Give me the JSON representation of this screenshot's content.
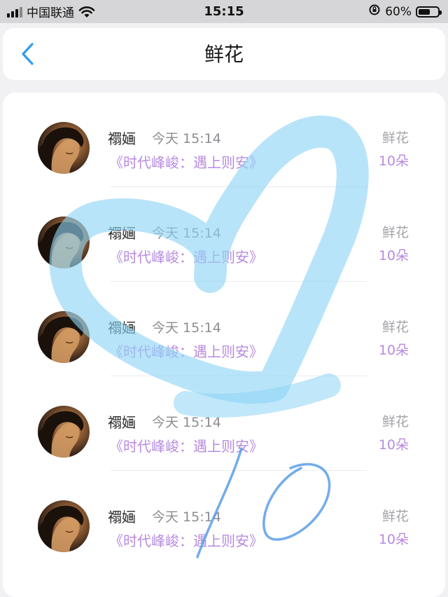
{
  "status_bar": {
    "carrier": "中国联通",
    "time": "15:15",
    "battery_percent": "60%",
    "battery_level": 0.6,
    "icons": [
      "signal-icon",
      "wifi-icon",
      "orientation-lock-icon",
      "battery-icon"
    ]
  },
  "nav": {
    "back_icon": "chevron-left-icon",
    "title": "鲜花"
  },
  "records": [
    {
      "name": "禤婳",
      "time": "今天 15:14",
      "book": "《时代峰峻：遇上则安》",
      "gift": "鲜花",
      "count": "10朵"
    },
    {
      "name": "禤婳",
      "time": "今天 15:14",
      "book": "《时代峰峻：遇上则安》",
      "gift": "鲜花",
      "count": "10朵"
    },
    {
      "name": "禤婳",
      "time": "今天 15:14",
      "book": "《时代峰峻：遇上则安》",
      "gift": "鲜花",
      "count": "10朵"
    },
    {
      "name": "禤婳",
      "time": "今天 15:14",
      "book": "《时代峰峻：遇上则安》",
      "gift": "鲜花",
      "count": "10朵"
    },
    {
      "name": "禤婳",
      "time": "今天 15:14",
      "book": "《时代峰峻：遇上则安》",
      "gift": "鲜花",
      "count": "10朵"
    }
  ],
  "overlay": {
    "description_icons": [
      "heart-doodle",
      "ten-doodle"
    ],
    "heart_color": "#8dd3f5",
    "number_color": "#5a9ee8"
  },
  "colors": {
    "accent": "#b78be0",
    "back": "#2f9cf0"
  }
}
